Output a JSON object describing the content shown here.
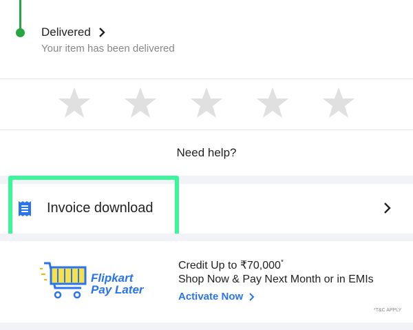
{
  "order_status": {
    "title": "Delivered",
    "subtitle": "Your item has been delivered"
  },
  "rating": {
    "star_count": 5,
    "selected": 0,
    "star_color": "#e0e0e0"
  },
  "help": {
    "label": "Need help?"
  },
  "invoice": {
    "label": "Invoice download",
    "icon": "receipt-icon",
    "highlight_color": "#3df59a"
  },
  "promo": {
    "brand_line1": "Flipkart",
    "brand_line2": "Pay Later",
    "credit_text": "Credit Up to ₹70,000",
    "credit_mark": "*",
    "tagline": "Shop Now & Pay Next Month or in EMIs",
    "cta": "Activate Now",
    "tc": "*T&C APPLY",
    "brand_color": "#2874f0",
    "cart_color": "#f7b300"
  },
  "colors": {
    "accent_green": "#26a541",
    "link_blue": "#2874f0"
  }
}
